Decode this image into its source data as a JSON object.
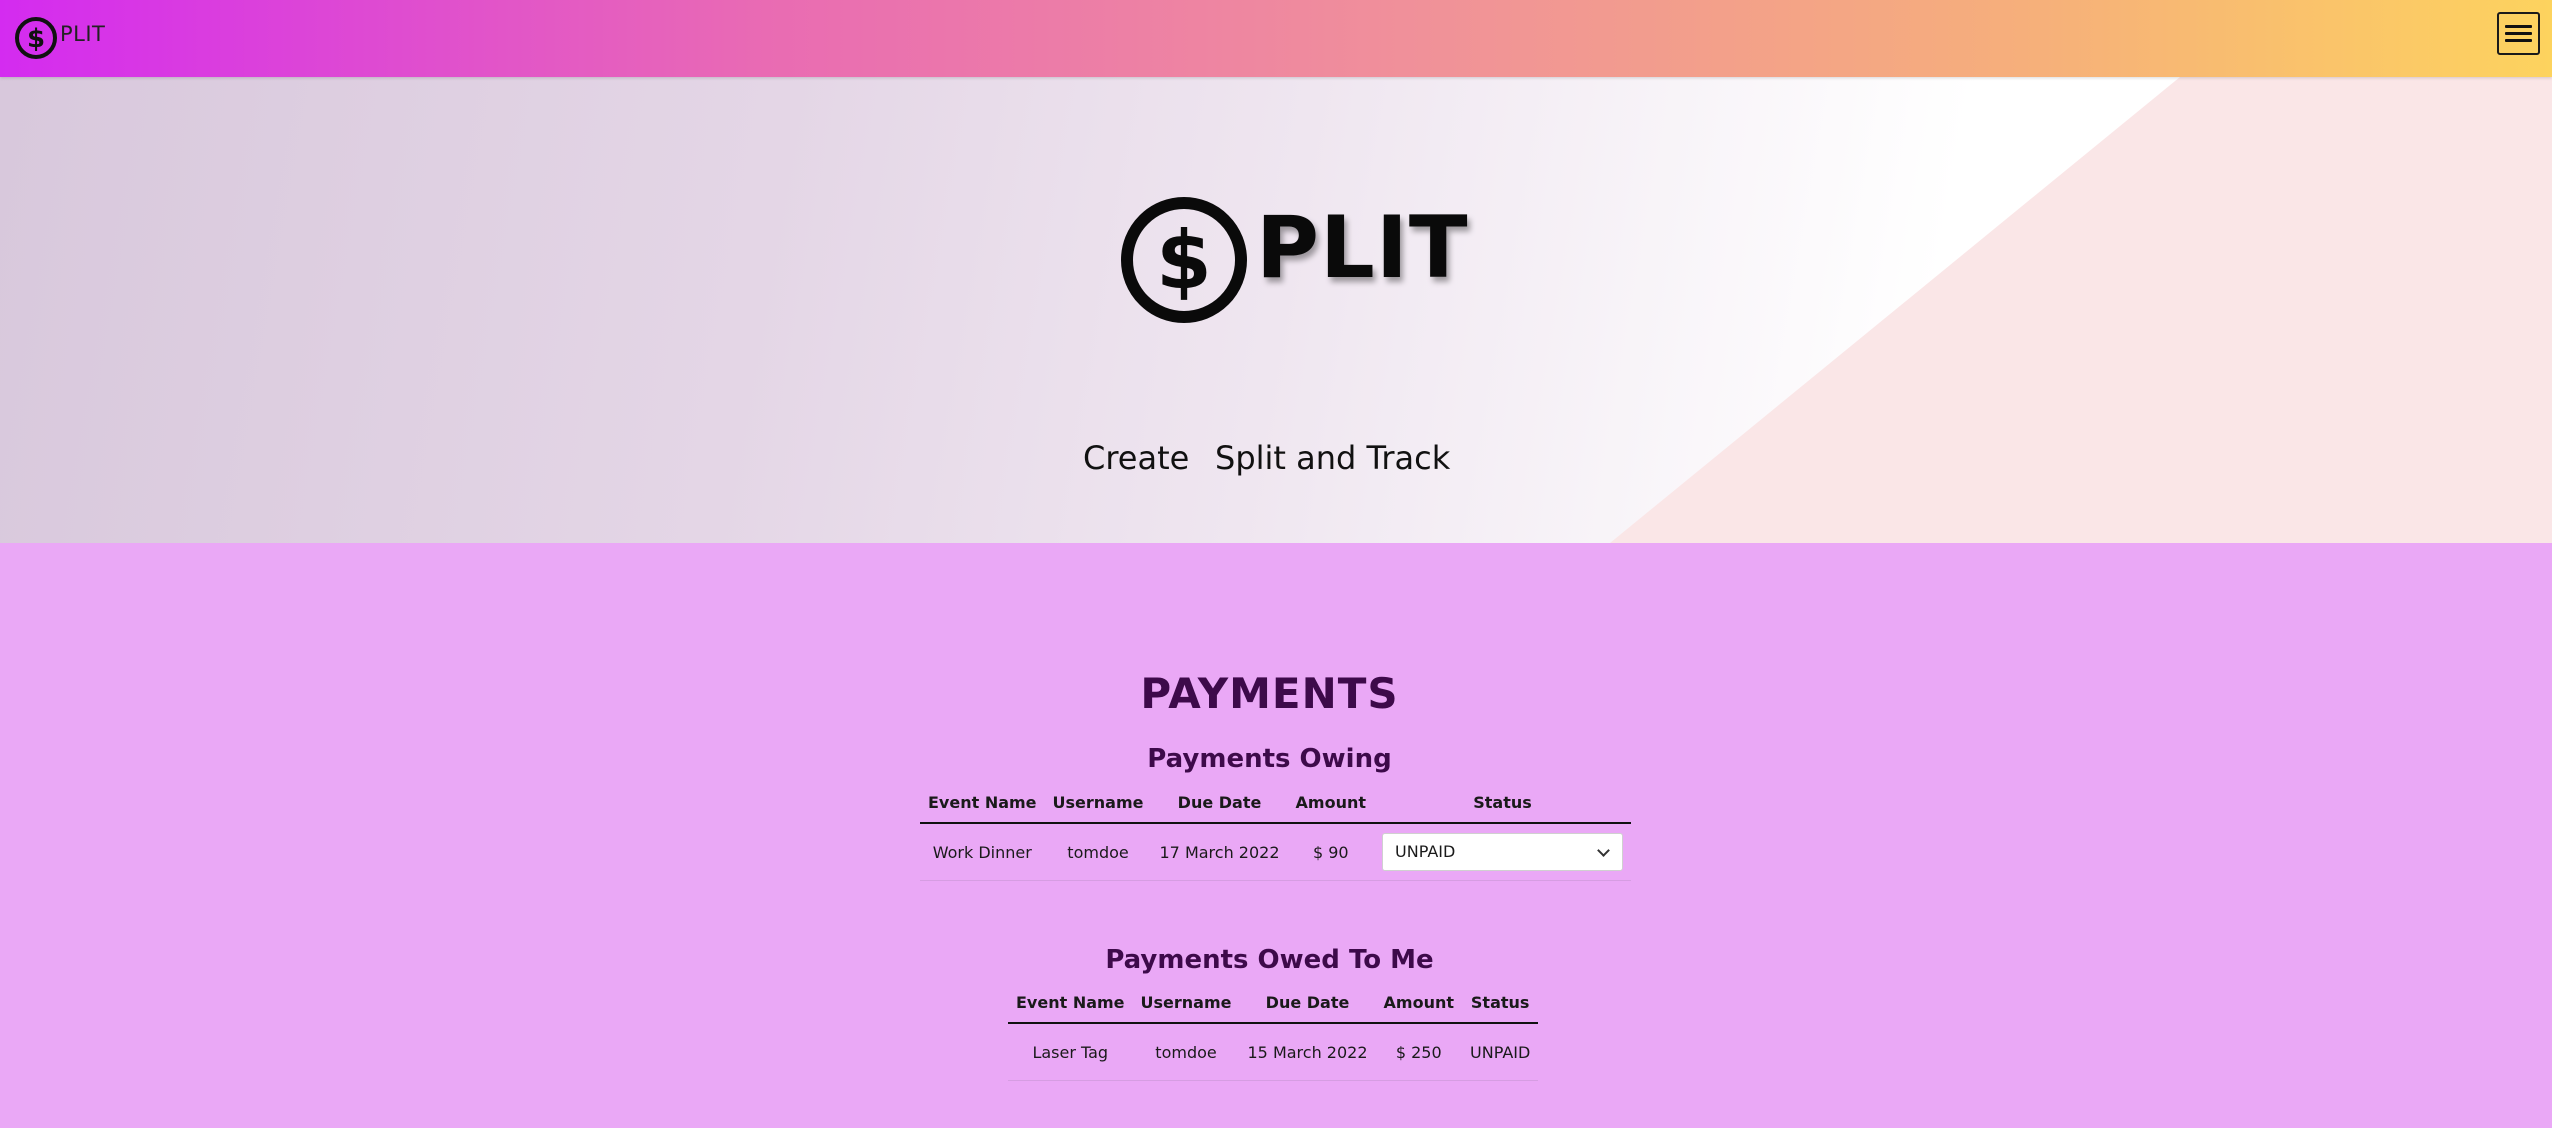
{
  "navbar": {
    "brand": "PLIT",
    "menu_toggle_label": "Toggle navigation",
    "gradient": [
      "#d42bf0",
      "#fdd35e"
    ]
  },
  "hero": {
    "wordmark": "PLIT",
    "tagline_create": "Create",
    "tagline_split": "Split and Track"
  },
  "payments": {
    "title": "PAYMENTS",
    "owing": {
      "title": "Payments Owing",
      "columns": [
        "Event Name",
        "Username",
        "Due Date",
        "Amount",
        "Status"
      ],
      "rows": [
        {
          "event": "Work Dinner",
          "username": "tomdoe",
          "due_date": "17 March 2022",
          "amount": "$ 90",
          "status": "UNPAID"
        }
      ]
    },
    "owed_to_me": {
      "title": "Payments Owed To Me",
      "columns": [
        "Event Name",
        "Username",
        "Due Date",
        "Amount",
        "Status"
      ],
      "rows": [
        {
          "event": "Laser Tag",
          "username": "tomdoe",
          "due_date": "15 March 2022",
          "amount": "$ 250",
          "status": "UNPAID"
        }
      ]
    }
  },
  "colors": {
    "section_bg": "#eaa8f6",
    "heading": "#3d0a4a"
  },
  "icons": {
    "logo": "dollar-circle-icon",
    "menu": "hamburger-icon",
    "select": "chevron-down-icon"
  }
}
